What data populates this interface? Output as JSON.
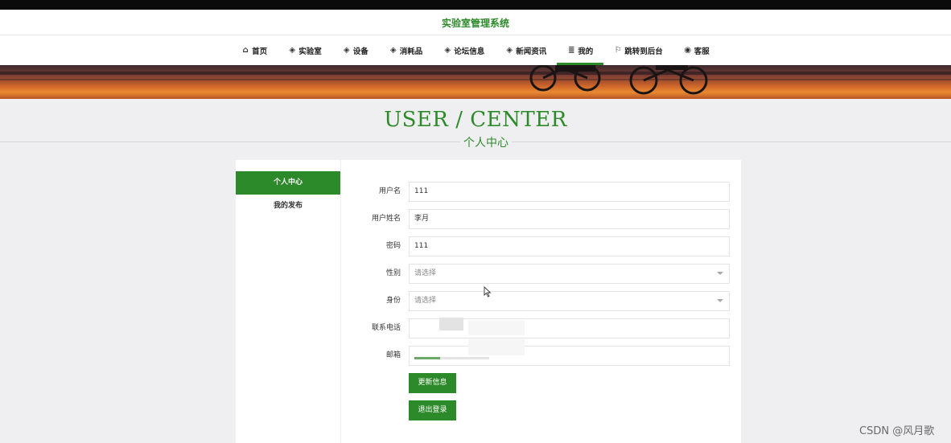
{
  "site_title": "实验室管理系统",
  "nav": [
    {
      "label": "首页",
      "icon": "home-icon",
      "glyph": "⌂"
    },
    {
      "label": "实验室",
      "icon": "cube-icon",
      "glyph": "◈"
    },
    {
      "label": "设备",
      "icon": "cube-icon",
      "glyph": "◈"
    },
    {
      "label": "消耗品",
      "icon": "cube-icon",
      "glyph": "◈"
    },
    {
      "label": "论坛信息",
      "icon": "cube-icon",
      "glyph": "◈"
    },
    {
      "label": "新闻资讯",
      "icon": "cube-icon",
      "glyph": "◈"
    },
    {
      "label": "我的",
      "icon": "list-icon",
      "glyph": "≣",
      "active": true
    },
    {
      "label": "跳转到后台",
      "icon": "flag-icon",
      "glyph": "⚐"
    },
    {
      "label": "客服",
      "icon": "chat-icon",
      "glyph": "◉"
    }
  ],
  "page_heading": "USER / CENTER",
  "page_subheading": "个人中心",
  "sidebar": [
    {
      "label": "个人中心",
      "active": true
    },
    {
      "label": "我的发布",
      "active": false
    }
  ],
  "form": {
    "username": {
      "label": "用户名",
      "value": "111"
    },
    "realname": {
      "label": "用户姓名",
      "value": "李月"
    },
    "password": {
      "label": "密码",
      "value": "111"
    },
    "gender": {
      "label": "性别",
      "value": "请选择"
    },
    "identity": {
      "label": "身份",
      "value": "请选择"
    },
    "phone": {
      "label": "联系电话",
      "value": ""
    },
    "email": {
      "label": "邮箱",
      "value": ""
    }
  },
  "buttons": {
    "update": "更新信息",
    "logout": "退出登录"
  },
  "watermark": "CSDN @风月歌",
  "colors": {
    "accent": "#2d8a2a",
    "background": "#efeff1"
  }
}
